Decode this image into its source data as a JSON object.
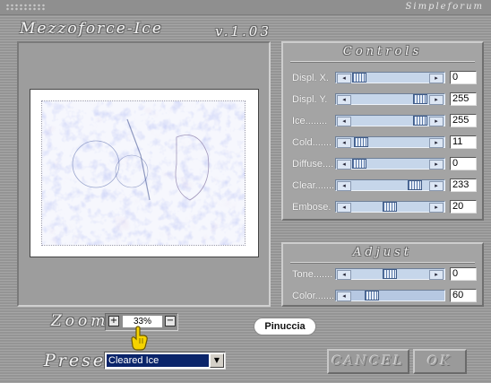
{
  "window": {
    "brand": "Simpleforum",
    "app_title": "Mezzoforce-Ice",
    "version": "v.1.03"
  },
  "controls": {
    "title": "Controls",
    "sliders": [
      {
        "label": "Displ. X.",
        "value": "0"
      },
      {
        "label": "Displ. Y.",
        "value": "255"
      },
      {
        "label": "Ice........",
        "value": "255"
      },
      {
        "label": "Cold.......",
        "value": "11"
      },
      {
        "label": "Diffuse....",
        "value": "0"
      },
      {
        "label": "Clear.......",
        "value": "233"
      },
      {
        "label": "Embose.",
        "value": "20"
      }
    ]
  },
  "adjust": {
    "title": "Adjust",
    "sliders": [
      {
        "label": "Tone.......",
        "value": "0"
      },
      {
        "label": "Color.......",
        "value": "60"
      }
    ]
  },
  "zoom": {
    "label": "Zoom",
    "value": "33%",
    "plus": "+",
    "minus": "−"
  },
  "badge": "Pinuccia",
  "preset": {
    "label": "Preset",
    "selected": "Cleared Ice"
  },
  "buttons": {
    "cancel": "CANCEL",
    "ok": "OK"
  },
  "colors": {
    "accent": "#c6d6ea",
    "selection": "#0a246a"
  }
}
